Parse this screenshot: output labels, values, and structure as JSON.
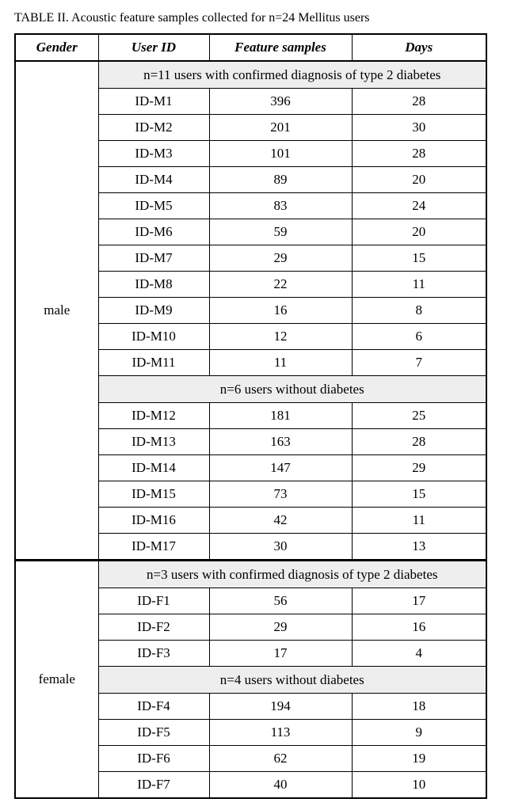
{
  "caption_fragment": "TABLE II. Acoustic feature samples collected for n=24 Mellitus users",
  "headers": [
    "Gender",
    "User ID",
    "Feature samples",
    "Days"
  ],
  "gender_labels": {
    "male": "male",
    "female": "female"
  },
  "groups": {
    "male_diabetic": {
      "subhead": "n=11 users with confirmed diagnosis of type 2 diabetes",
      "rows": [
        [
          "ID-M1",
          "396",
          "28"
        ],
        [
          "ID-M2",
          "201",
          "30"
        ],
        [
          "ID-M3",
          "101",
          "28"
        ],
        [
          "ID-M4",
          "89",
          "20"
        ],
        [
          "ID-M5",
          "83",
          "24"
        ],
        [
          "ID-M6",
          "59",
          "20"
        ],
        [
          "ID-M7",
          "29",
          "15"
        ],
        [
          "ID-M8",
          "22",
          "11"
        ],
        [
          "ID-M9",
          "16",
          "8"
        ],
        [
          "ID-M10",
          "12",
          "6"
        ],
        [
          "ID-M11",
          "11",
          "7"
        ]
      ]
    },
    "male_nondiabetic": {
      "subhead": "n=6 users without diabetes",
      "rows": [
        [
          "ID-M12",
          "181",
          "25"
        ],
        [
          "ID-M13",
          "163",
          "28"
        ],
        [
          "ID-M14",
          "147",
          "29"
        ],
        [
          "ID-M15",
          "73",
          "15"
        ],
        [
          "ID-M16",
          "42",
          "11"
        ],
        [
          "ID-M17",
          "30",
          "13"
        ]
      ]
    },
    "female_diabetic": {
      "subhead": "n=3 users with confirmed diagnosis of type 2 diabetes",
      "rows": [
        [
          "ID-F1",
          "56",
          "17"
        ],
        [
          "ID-F2",
          "29",
          "16"
        ],
        [
          "ID-F3",
          "17",
          "4"
        ]
      ]
    },
    "female_nondiabetic": {
      "subhead": "n=4 users without diabetes",
      "rows": [
        [
          "ID-F4",
          "194",
          "18"
        ],
        [
          "ID-F5",
          "113",
          "9"
        ],
        [
          "ID-F6",
          "62",
          "19"
        ],
        [
          "ID-F7",
          "40",
          "10"
        ]
      ]
    }
  },
  "chart_data": {
    "type": "table",
    "title": "Acoustic feature samples collected for n=24 Mellitus users",
    "columns": [
      "Gender",
      "User ID",
      "Feature samples",
      "Days"
    ],
    "records": [
      {
        "gender": "male",
        "group": "type 2 diabetes",
        "user_id": "ID-M1",
        "feature_samples": 396,
        "days": 28
      },
      {
        "gender": "male",
        "group": "type 2 diabetes",
        "user_id": "ID-M2",
        "feature_samples": 201,
        "days": 30
      },
      {
        "gender": "male",
        "group": "type 2 diabetes",
        "user_id": "ID-M3",
        "feature_samples": 101,
        "days": 28
      },
      {
        "gender": "male",
        "group": "type 2 diabetes",
        "user_id": "ID-M4",
        "feature_samples": 89,
        "days": 20
      },
      {
        "gender": "male",
        "group": "type 2 diabetes",
        "user_id": "ID-M5",
        "feature_samples": 83,
        "days": 24
      },
      {
        "gender": "male",
        "group": "type 2 diabetes",
        "user_id": "ID-M6",
        "feature_samples": 59,
        "days": 20
      },
      {
        "gender": "male",
        "group": "type 2 diabetes",
        "user_id": "ID-M7",
        "feature_samples": 29,
        "days": 15
      },
      {
        "gender": "male",
        "group": "type 2 diabetes",
        "user_id": "ID-M8",
        "feature_samples": 22,
        "days": 11
      },
      {
        "gender": "male",
        "group": "type 2 diabetes",
        "user_id": "ID-M9",
        "feature_samples": 16,
        "days": 8
      },
      {
        "gender": "male",
        "group": "type 2 diabetes",
        "user_id": "ID-M10",
        "feature_samples": 12,
        "days": 6
      },
      {
        "gender": "male",
        "group": "type 2 diabetes",
        "user_id": "ID-M11",
        "feature_samples": 11,
        "days": 7
      },
      {
        "gender": "male",
        "group": "no diabetes",
        "user_id": "ID-M12",
        "feature_samples": 181,
        "days": 25
      },
      {
        "gender": "male",
        "group": "no diabetes",
        "user_id": "ID-M13",
        "feature_samples": 163,
        "days": 28
      },
      {
        "gender": "male",
        "group": "no diabetes",
        "user_id": "ID-M14",
        "feature_samples": 147,
        "days": 29
      },
      {
        "gender": "male",
        "group": "no diabetes",
        "user_id": "ID-M15",
        "feature_samples": 73,
        "days": 15
      },
      {
        "gender": "male",
        "group": "no diabetes",
        "user_id": "ID-M16",
        "feature_samples": 42,
        "days": 11
      },
      {
        "gender": "male",
        "group": "no diabetes",
        "user_id": "ID-M17",
        "feature_samples": 30,
        "days": 13
      },
      {
        "gender": "female",
        "group": "type 2 diabetes",
        "user_id": "ID-F1",
        "feature_samples": 56,
        "days": 17
      },
      {
        "gender": "female",
        "group": "type 2 diabetes",
        "user_id": "ID-F2",
        "feature_samples": 29,
        "days": 16
      },
      {
        "gender": "female",
        "group": "type 2 diabetes",
        "user_id": "ID-F3",
        "feature_samples": 17,
        "days": 4
      },
      {
        "gender": "female",
        "group": "no diabetes",
        "user_id": "ID-F4",
        "feature_samples": 194,
        "days": 18
      },
      {
        "gender": "female",
        "group": "no diabetes",
        "user_id": "ID-F5",
        "feature_samples": 113,
        "days": 9
      },
      {
        "gender": "female",
        "group": "no diabetes",
        "user_id": "ID-F6",
        "feature_samples": 62,
        "days": 19
      },
      {
        "gender": "female",
        "group": "no diabetes",
        "user_id": "ID-F7",
        "feature_samples": 40,
        "days": 10
      }
    ]
  }
}
